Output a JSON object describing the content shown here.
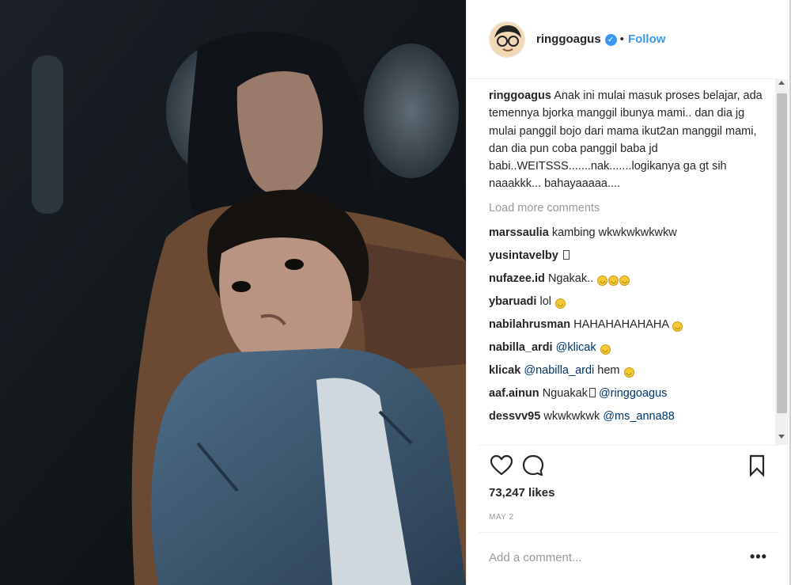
{
  "post": {
    "username": "ringgoagus",
    "verified_icon": "check-icon",
    "separator": "•",
    "follow_label": "Follow"
  },
  "caption": {
    "username": "ringgoagus",
    "text": "Anak ini mulai masuk proses belajar, ada temennya bjorka manggil ibunya mami.. dan dia jg mulai panggil bojo dari mama ikut2an manggil mami, dan dia pun coba panggil baba jd babi..WEITSSS.......nak.......logikanya ga gt sih naaakkk... bahayaaaaa...."
  },
  "load_more_label": "Load more comments",
  "comments": [
    {
      "username": "marssaulia",
      "text": "kambing wkwkwkwkwkw",
      "mention": "",
      "trailing": "",
      "emoji_count": 0,
      "box": false
    },
    {
      "username": "yusintavelby",
      "text": "",
      "mention": "",
      "trailing": "",
      "emoji_count": 0,
      "box": true
    },
    {
      "username": "nufazee.id",
      "text": "Ngakak..",
      "mention": "",
      "trailing": "",
      "emoji_count": 3,
      "box": false
    },
    {
      "username": "ybaruadi",
      "text": "lol",
      "mention": "",
      "trailing": "",
      "emoji_count": 1,
      "box": false
    },
    {
      "username": "nabilahrusman",
      "text": "HAHAHAHAHAHA",
      "mention": "",
      "trailing": "",
      "emoji_count": 1,
      "box": false
    },
    {
      "username": "nabilla_ardi",
      "text": "",
      "mention": "@klicak",
      "trailing": "",
      "emoji_count": 1,
      "box": false
    },
    {
      "username": "klicak",
      "text": "",
      "mention": "@nabilla_ardi",
      "trailing": "hem",
      "emoji_count": 1,
      "box": false
    },
    {
      "username": "aaf.ainun",
      "text": "Nguakak",
      "mention": "@ringgoagus",
      "trailing": "",
      "emoji_count": 0,
      "box": true
    },
    {
      "username": "dessvv95",
      "text": "wkwkwkwk",
      "mention": "@ms_anna88",
      "trailing": "",
      "emoji_count": 0,
      "box": false
    }
  ],
  "actions": {
    "like_icon": "heart-icon",
    "comment_icon": "comment-icon",
    "save_icon": "bookmark-icon"
  },
  "likes": "73,247 likes",
  "date": "MAY 2",
  "add_comment_placeholder": "Add a comment...",
  "more_icon": "more-options-icon",
  "colors": {
    "link_blue": "#3897f0",
    "text": "#262626",
    "muted": "#999999",
    "mention": "#003569"
  }
}
